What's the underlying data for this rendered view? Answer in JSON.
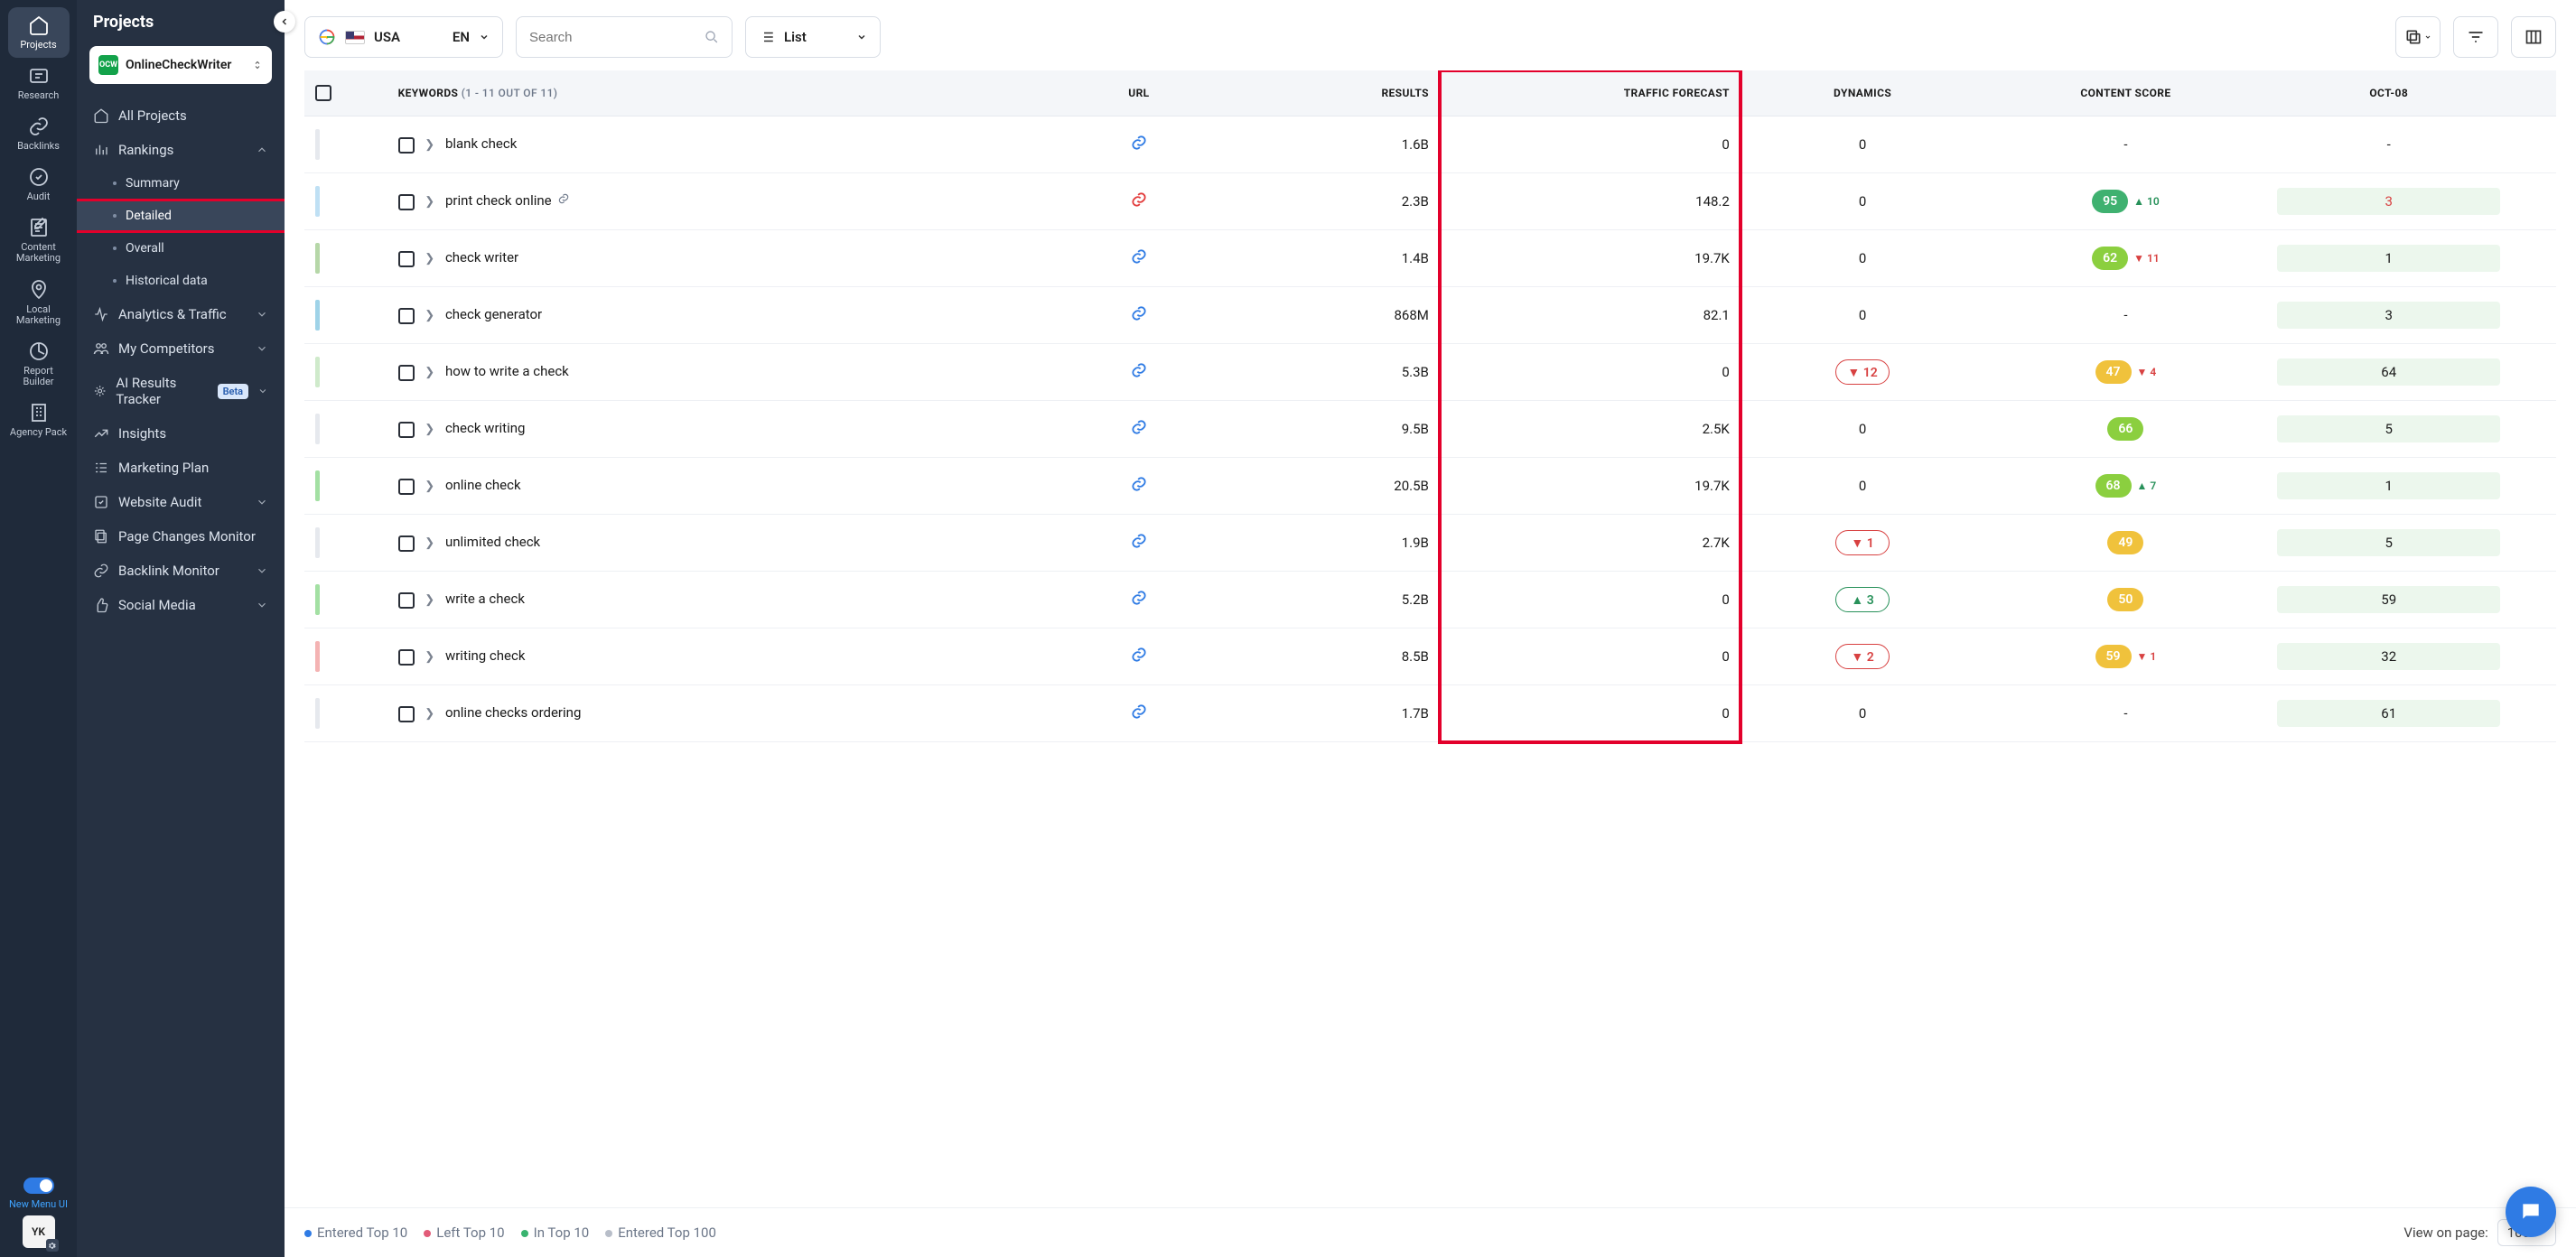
{
  "rail": {
    "items": [
      {
        "id": "projects",
        "label": "Projects",
        "active": true
      },
      {
        "id": "research",
        "label": "Research"
      },
      {
        "id": "backlinks",
        "label": "Backlinks"
      },
      {
        "id": "audit",
        "label": "Audit"
      },
      {
        "id": "content",
        "label": "Content\nMarketing"
      },
      {
        "id": "local",
        "label": "Local\nMarketing"
      },
      {
        "id": "report",
        "label": "Report\nBuilder"
      },
      {
        "id": "agency",
        "label": "Agency\nPack"
      }
    ],
    "toggle_label": "New Menu UI",
    "avatar": "YK"
  },
  "sidebar": {
    "title": "Projects",
    "project": "OnlineCheckWriter",
    "nav": [
      {
        "id": "all",
        "label": "All Projects",
        "icon": "home"
      },
      {
        "id": "rankings",
        "label": "Rankings",
        "icon": "bars",
        "expandable": true,
        "open": true,
        "children": [
          {
            "id": "summary",
            "label": "Summary"
          },
          {
            "id": "detailed",
            "label": "Detailed",
            "active": true
          },
          {
            "id": "overall",
            "label": "Overall"
          },
          {
            "id": "historical",
            "label": "Historical data"
          }
        ]
      },
      {
        "id": "analytics",
        "label": "Analytics & Traffic",
        "icon": "pulse",
        "expandable": true
      },
      {
        "id": "competitors",
        "label": "My Competitors",
        "icon": "people",
        "expandable": true
      },
      {
        "id": "airt",
        "label": "AI Results Tracker",
        "icon": "sparkle",
        "expandable": true,
        "badge": "Beta"
      },
      {
        "id": "insights",
        "label": "Insights",
        "icon": "trend"
      },
      {
        "id": "mplan",
        "label": "Marketing Plan",
        "icon": "checklist"
      },
      {
        "id": "waudit",
        "label": "Website Audit",
        "icon": "shield",
        "expandable": true
      },
      {
        "id": "pcm",
        "label": "Page Changes Monitor",
        "icon": "copy"
      },
      {
        "id": "blm",
        "label": "Backlink Monitor",
        "icon": "link",
        "expandable": true
      },
      {
        "id": "social",
        "label": "Social Media",
        "icon": "thumb",
        "expandable": true
      }
    ]
  },
  "toolbar": {
    "country": "USA",
    "lang": "EN",
    "search_placeholder": "Search",
    "view": "List"
  },
  "table": {
    "header": {
      "keywords": "KEYWORDS",
      "keywords_sub": "(1 - 11 OUT OF 11)",
      "url": "URL",
      "results": "RESULTS",
      "traffic": "TRAFFIC FORECAST",
      "dynamics": "DYNAMICS",
      "content": "CONTENT SCORE",
      "date": "OCT-08"
    },
    "rows": [
      {
        "bar": "#e6e9ee",
        "kw": "blank check",
        "url": "blue",
        "results": "1.6B",
        "traffic": "0",
        "dyn": {
          "text": "0"
        },
        "score": null,
        "oct": "-",
        "link": false
      },
      {
        "bar": "#bfe0f4",
        "kw": "print check online",
        "url": "red",
        "results": "2.3B",
        "traffic": "148.2",
        "dyn": {
          "text": "0"
        },
        "score": {
          "v": "95",
          "c": "sc-green",
          "d": "▲ 10",
          "dc": "up"
        },
        "oct": "3",
        "oct_red": true,
        "link": true
      },
      {
        "bar": "#b6d7a8",
        "kw": "check writer",
        "url": "blue",
        "results": "1.4B",
        "traffic": "19.7K",
        "dyn": {
          "text": "0"
        },
        "score": {
          "v": "62",
          "c": "sc-lime",
          "d": "▼ 11",
          "dc": "down"
        },
        "oct": "1",
        "link": false
      },
      {
        "bar": "#9fd3e8",
        "kw": "check generator",
        "url": "blue",
        "results": "868M",
        "traffic": "82.1",
        "dyn": {
          "text": "0"
        },
        "score": null,
        "oct": "3",
        "link": false
      },
      {
        "bar": "#cfeacb",
        "kw": "how to write a check",
        "url": "blue",
        "results": "5.3B",
        "traffic": "0",
        "dyn": {
          "pill": "▼ 12",
          "pc": "dyn-down"
        },
        "score": {
          "v": "47",
          "c": "sc-yellow",
          "d": "▼ 4",
          "dc": "down"
        },
        "oct": "64",
        "link": false
      },
      {
        "bar": "#e6e9ee",
        "kw": "check writing",
        "url": "blue",
        "results": "9.5B",
        "traffic": "2.5K",
        "dyn": {
          "text": "0"
        },
        "score": {
          "v": "66",
          "c": "sc-lime"
        },
        "oct": "5",
        "link": false
      },
      {
        "bar": "#a3e0a3",
        "kw": "online check",
        "url": "blue",
        "results": "20.5B",
        "traffic": "19.7K",
        "dyn": {
          "text": "0"
        },
        "score": {
          "v": "68",
          "c": "sc-lime",
          "d": "▲ 7",
          "dc": "up"
        },
        "oct": "1",
        "link": false
      },
      {
        "bar": "#e6e9ee",
        "kw": "unlimited check",
        "url": "blue",
        "results": "1.9B",
        "traffic": "2.7K",
        "dyn": {
          "pill": "▼ 1",
          "pc": "dyn-down"
        },
        "score": {
          "v": "49",
          "c": "sc-yellow"
        },
        "oct": "5",
        "link": false
      },
      {
        "bar": "#a3e0a3",
        "kw": "write a check",
        "url": "blue",
        "results": "5.2B",
        "traffic": "0",
        "dyn": {
          "pill": "▲ 3",
          "pc": "dyn-up"
        },
        "score": {
          "v": "50",
          "c": "sc-yellow"
        },
        "oct": "59",
        "link": false
      },
      {
        "bar": "#f4b3b3",
        "kw": "writing check",
        "url": "blue",
        "results": "8.5B",
        "traffic": "0",
        "dyn": {
          "pill": "▼ 2",
          "pc": "dyn-down"
        },
        "score": {
          "v": "59",
          "c": "sc-yellow",
          "d": "▼ 1",
          "dc": "down"
        },
        "oct": "32",
        "link": false
      },
      {
        "bar": "#e6e9ee",
        "kw": "online checks ordering",
        "url": "blue",
        "results": "1.7B",
        "traffic": "0",
        "dyn": {
          "text": "0"
        },
        "score": null,
        "oct": "61",
        "link": false
      }
    ]
  },
  "legend": [
    {
      "color": "#2f7be4",
      "label": "Entered Top 10"
    },
    {
      "color": "#e25b78",
      "label": "Left Top 10"
    },
    {
      "color": "#39b36f",
      "label": "In Top 10"
    },
    {
      "color": "#b8bec9",
      "label": "Entered Top 100"
    }
  ],
  "footer": {
    "view_label": "View on page:",
    "per_page": "100"
  }
}
